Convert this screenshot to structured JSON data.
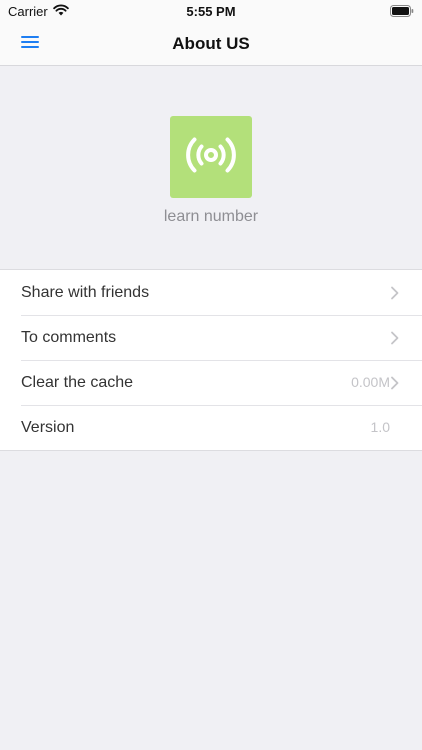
{
  "status_bar": {
    "carrier": "Carrier",
    "time": "5:55 PM",
    "icons": [
      "wifi-icon",
      "battery-icon"
    ]
  },
  "nav": {
    "title": "About US",
    "menu_icon": "hamburger-menu-icon"
  },
  "app": {
    "name": "learn number",
    "logo_icon": "broadcast-signal-icon",
    "logo_color": "#b3e07a"
  },
  "settings": {
    "items": [
      {
        "label": "Share with friends",
        "value": "",
        "chevron": true
      },
      {
        "label": "To comments",
        "value": "",
        "chevron": true
      },
      {
        "label": "Clear the cache",
        "value": "0.00M",
        "chevron": true
      },
      {
        "label": "Version",
        "value": "1.0",
        "chevron": false
      }
    ]
  },
  "colors": {
    "accent": "#1e7ef2",
    "background": "#f0f0f4"
  }
}
